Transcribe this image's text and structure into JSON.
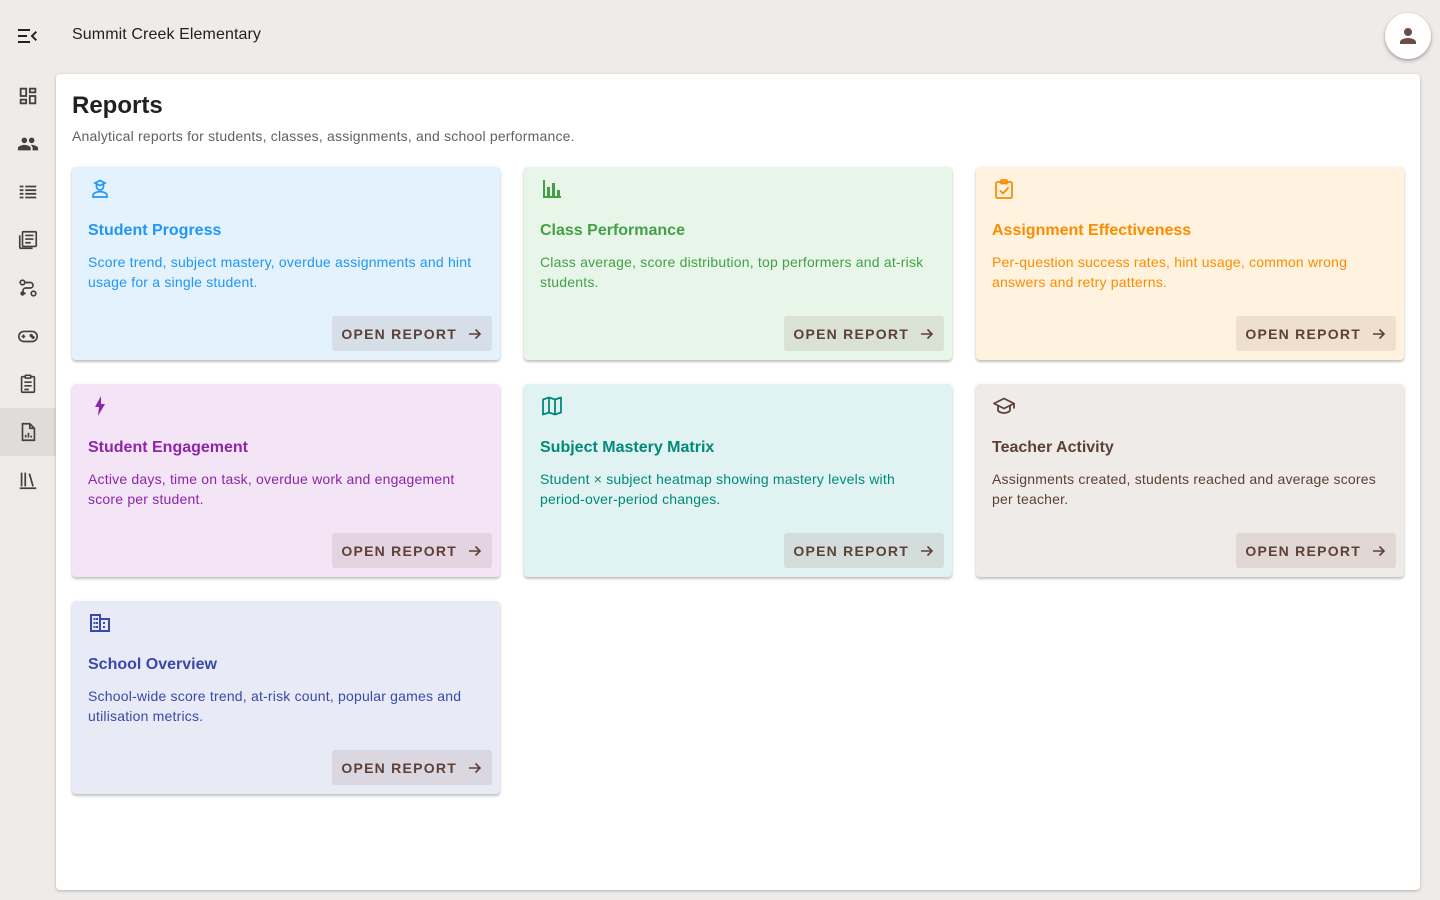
{
  "app": {
    "title": "Summit Creek Elementary"
  },
  "icons": {
    "menu": "menu-open-icon",
    "account": "person-icon"
  },
  "rail": [
    {
      "icon": "dashboard-icon",
      "active": false
    },
    {
      "icon": "people-icon",
      "active": false
    },
    {
      "icon": "list-icon",
      "active": false
    },
    {
      "icon": "newspaper-icon",
      "active": false
    },
    {
      "icon": "route-icon",
      "active": false
    },
    {
      "icon": "gamepad-icon",
      "active": false
    },
    {
      "icon": "clipboard-icon",
      "active": false
    },
    {
      "icon": "report-icon",
      "active": true
    },
    {
      "icon": "library-icon",
      "active": false
    }
  ],
  "page": {
    "title": "Reports",
    "subtitle": "Analytical reports for students, classes, assignments, and school performance."
  },
  "cards": [
    {
      "icon": "student-icon",
      "title": "Student Progress",
      "desc": "Score trend, subject mastery, overdue assignments and hint usage for a single student.",
      "button": "OPEN REPORT",
      "color": "#2196f3",
      "bg": "#e3f2fd"
    },
    {
      "icon": "bar-chart-icon",
      "title": "Class Performance",
      "desc": "Class average, score distribution, top performers and at-risk students.",
      "button": "OPEN REPORT",
      "color": "#43a047",
      "bg": "#e8f5e9"
    },
    {
      "icon": "assignment-check-icon",
      "title": "Assignment Effectiveness",
      "desc": "Per-question success rates, hint usage, common wrong answers and retry patterns.",
      "button": "OPEN REPORT",
      "color": "#fb8c00",
      "bg": "#fff3e0"
    },
    {
      "icon": "bolt-icon",
      "title": "Student Engagement",
      "desc": "Active days, time on task, overdue work and engagement score per student.",
      "button": "OPEN REPORT",
      "color": "#8e24aa",
      "bg": "#f3e5f5"
    },
    {
      "icon": "map-icon",
      "title": "Subject Mastery Matrix",
      "desc": "Student × subject heatmap showing mastery levels with period-over-period changes.",
      "button": "OPEN REPORT",
      "color": "#00897b",
      "bg": "#e0f2f1"
    },
    {
      "icon": "school-icon",
      "title": "Teacher Activity",
      "desc": "Assignments created, students reached and average scores per teacher.",
      "button": "OPEN REPORT",
      "color": "#5d4037",
      "bg": "#efebe9"
    },
    {
      "icon": "building-icon",
      "title": "School Overview",
      "desc": "School-wide score trend, at-risk count, popular games and utilisation metrics.",
      "button": "OPEN REPORT",
      "color": "#3949ab",
      "bg": "#e8eaf6"
    }
  ]
}
